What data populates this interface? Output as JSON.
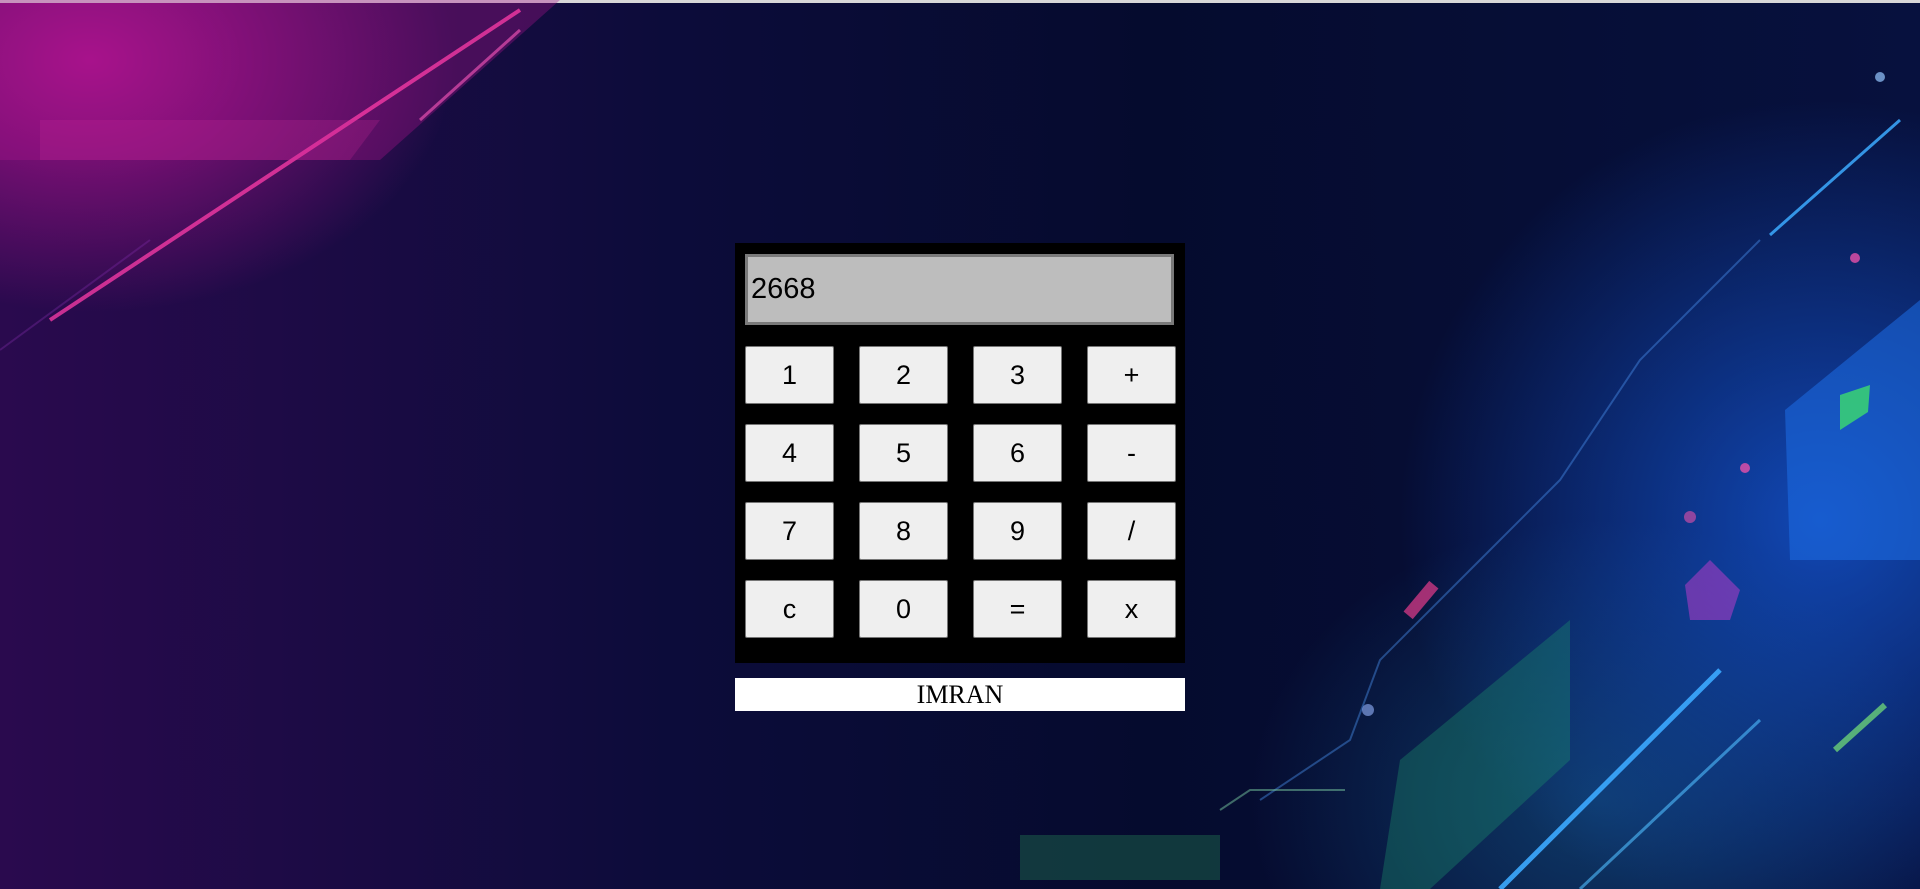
{
  "calculator": {
    "display_value": "2668",
    "keys": [
      {
        "label": "1",
        "name": "key-1"
      },
      {
        "label": "2",
        "name": "key-2"
      },
      {
        "label": "3",
        "name": "key-3"
      },
      {
        "label": "+",
        "name": "key-add"
      },
      {
        "label": "4",
        "name": "key-4"
      },
      {
        "label": "5",
        "name": "key-5"
      },
      {
        "label": "6",
        "name": "key-6"
      },
      {
        "label": "-",
        "name": "key-subtract"
      },
      {
        "label": "7",
        "name": "key-7"
      },
      {
        "label": "8",
        "name": "key-8"
      },
      {
        "label": "9",
        "name": "key-9"
      },
      {
        "label": "/",
        "name": "key-divide"
      },
      {
        "label": "c",
        "name": "key-clear"
      },
      {
        "label": "0",
        "name": "key-0"
      },
      {
        "label": "=",
        "name": "key-equals"
      },
      {
        "label": "x",
        "name": "key-multiply"
      }
    ]
  },
  "footer": {
    "author": "IMRAN"
  },
  "colors": {
    "calculator_body": "#000000",
    "display_background": "#bdbdbd",
    "key_background": "#efefef",
    "footer_background": "#ffffff"
  }
}
